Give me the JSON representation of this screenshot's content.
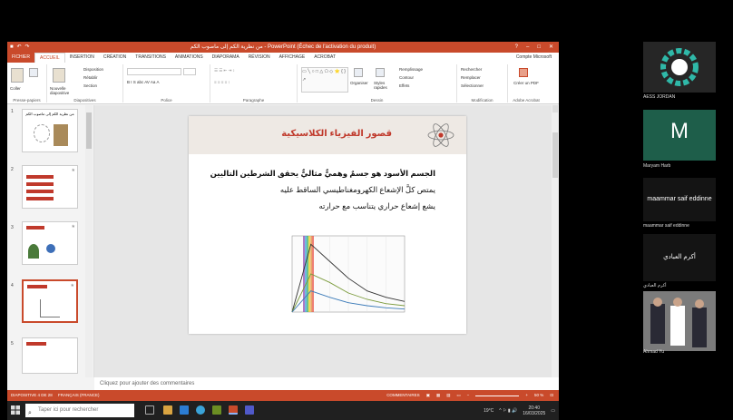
{
  "window": {
    "title": "من نظرية الكم إلى ماصوب الكم - PowerPoint (Échec de l'activation du produit)",
    "help": "?",
    "controls": [
      "–",
      "□",
      "✕"
    ]
  },
  "tabs": [
    {
      "label": "FICHIER"
    },
    {
      "label": "ACCUEIL"
    },
    {
      "label": "INSERTION"
    },
    {
      "label": "CRÉATION"
    },
    {
      "label": "TRANSITIONS"
    },
    {
      "label": "ANIMATIONS"
    },
    {
      "label": "DIAPORAMA"
    },
    {
      "label": "RÉVISION"
    },
    {
      "label": "AFFICHAGE"
    },
    {
      "label": "ACROBAT"
    }
  ],
  "account": "Compte Microsoft",
  "ribbon": {
    "clipboard": {
      "paste": "Coller",
      "group": "Presse-papiers"
    },
    "slides": {
      "new_slide": "Nouvelle diapositive",
      "layout": "Disposition",
      "reset": "Rétablir",
      "section": "Section",
      "group": "Diapositives"
    },
    "font": {
      "buttons": "B I S abc AV Aa A",
      "group": "Police"
    },
    "paragraph": {
      "group": "Paragraphe"
    },
    "drawing": {
      "arrange": "Organiser",
      "styles": "Styles rapides",
      "fill": "Remplissage",
      "outline": "Contour",
      "effects": "Effets",
      "group": "Dessin"
    },
    "editing": {
      "find": "Rechercher",
      "replace": "Remplacer",
      "select": "Sélectionner",
      "group": "Modification"
    },
    "acrobat": {
      "create_pdf": "Créer un PDF",
      "group": "Adobe Acrobat"
    }
  },
  "thumbnails": [
    {
      "num": "1",
      "title": "من نظرية الكم إلى ماصوب الكم"
    },
    {
      "num": "2",
      "title": ""
    },
    {
      "num": "3",
      "title": ""
    },
    {
      "num": "4",
      "title": ""
    },
    {
      "num": "5",
      "title": ""
    }
  ],
  "slide": {
    "title": "قصور الفيزياء الكلاسيكية",
    "lines": [
      "الجسم الأسود هو جسمٌ وهميٌّ مثاليٌّ يحقق الشرطين التاليين",
      "يمتص كلَّ الإشعاع الكهرومغناطيسي الساقط عليه",
      "يشع إشعاع حراري يتناسب مع حرارته"
    ]
  },
  "chart_data": {
    "type": "line",
    "x": [
      0,
      500,
      1000,
      1500,
      2000,
      2500,
      3000
    ],
    "series": [
      {
        "values": [
          0,
          1.6,
          1.2,
          0.8,
          0.5,
          0.35,
          0.25
        ]
      },
      {
        "values": [
          0,
          0.9,
          0.7,
          0.45,
          0.3,
          0.2,
          0.15
        ]
      },
      {
        "values": [
          0,
          0.5,
          0.35,
          0.22,
          0.15,
          0.1,
          0.07
        ]
      }
    ],
    "ylim": [
      0,
      1.8
    ]
  },
  "notes": "Cliquez pour ajouter des commentaires",
  "status": {
    "slide": "DIAPOSITIVE 4 DE 28",
    "language": "FRANÇAIS (FRANCE)",
    "comments_label": "COMMENTAIRES",
    "zoom": "50 %"
  },
  "taskbar": {
    "search_placeholder": "Taper ici pour rechercher",
    "weather": "19°C",
    "time": "20:40",
    "date": "16/03/2025"
  },
  "participants": [
    {
      "name": "AESS JORDAN"
    },
    {
      "name": "Maryam Harb",
      "initial": "M"
    },
    {
      "name": "maammar saif eddinne",
      "tile_text": "maammar saif eddinne"
    },
    {
      "name": "أكرم العبادي",
      "tile_text": "أكرم العبادي"
    },
    {
      "name": "Ahmad Yu"
    }
  ],
  "colors": {
    "ppt_red": "#c94a2b",
    "taskbar": "#202020",
    "maryam_tile": "#1e5e4a"
  }
}
